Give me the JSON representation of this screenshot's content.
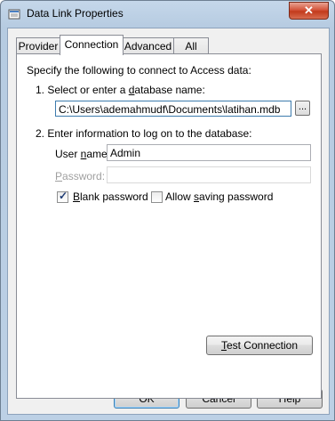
{
  "window": {
    "title": "Data Link Properties",
    "close_glyph": "✕"
  },
  "tabs": [
    {
      "label": "Provider",
      "active": false
    },
    {
      "label": "Connection",
      "active": true
    },
    {
      "label": "Advanced",
      "active": false
    },
    {
      "label": "All",
      "active": false
    }
  ],
  "connection": {
    "intro": "Specify the following to connect to Access data:",
    "step1": {
      "pre": "1. Select or enter a ",
      "accel": "d",
      "post": "atabase name:"
    },
    "database_name": "C:\\Users\\ademahmudf\\Documents\\latihan.mdb",
    "browse_label": "...",
    "step2": "2. Enter information to log on to the database:",
    "username_label": {
      "pre": "User ",
      "accel": "n",
      "post": "ame:"
    },
    "username_value": "Admin",
    "password_label": {
      "pre": "",
      "accel": "P",
      "post": "assword:"
    },
    "password_value": "",
    "blank_password": {
      "pre": "",
      "accel": "B",
      "post": "lank password",
      "checked": true
    },
    "allow_saving": {
      "pre": "Allow ",
      "accel": "s",
      "post": "aving password",
      "checked": false
    },
    "test_connection": {
      "pre": "",
      "accel": "T",
      "post": "est Connection"
    }
  },
  "footer": {
    "ok": "OK",
    "cancel": "Cancel",
    "help": "Help"
  }
}
